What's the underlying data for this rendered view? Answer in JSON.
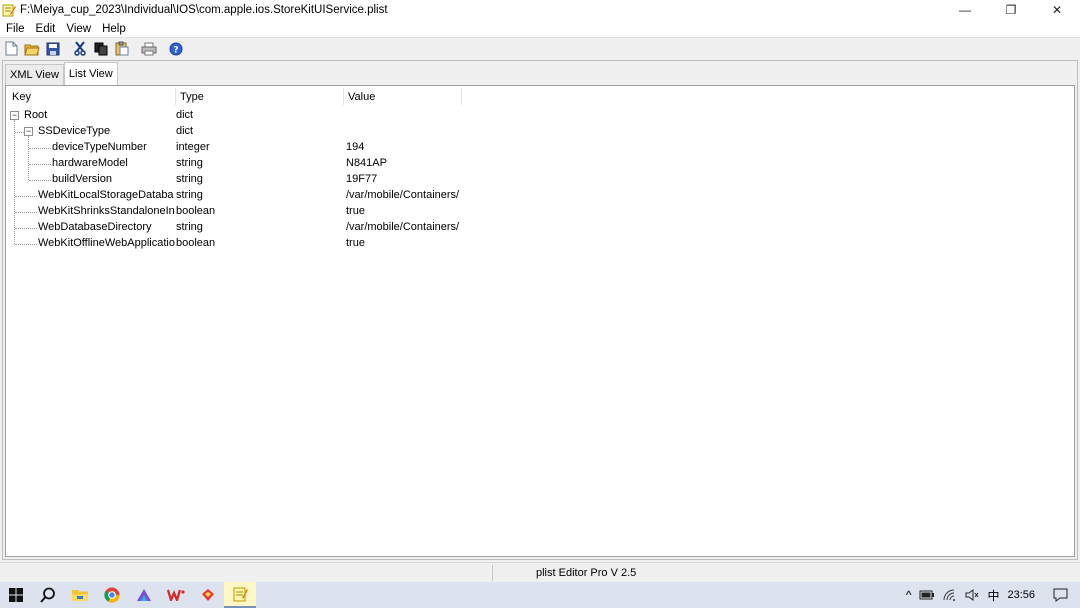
{
  "window": {
    "title": "F:\\Meiya_cup_2023\\Individual\\IOS\\com.apple.ios.StoreKitUIService.plist",
    "minimize": "—",
    "restore": "❐",
    "close": "✕"
  },
  "menu": [
    "File",
    "Edit",
    "View",
    "Help"
  ],
  "toolbar": {
    "icons": [
      "new-file-icon",
      "open-folder-icon",
      "save-icon",
      "cut-icon",
      "copy-icon",
      "paste-icon",
      "print-icon",
      "help-icon"
    ]
  },
  "tabs": [
    {
      "label": "XML View",
      "active": false
    },
    {
      "label": "List View",
      "active": true
    }
  ],
  "list": {
    "headers": {
      "key": "Key",
      "type": "Type",
      "value": "Value"
    },
    "rows": [
      {
        "key": "Root",
        "type": "dict",
        "value": "",
        "level": 0,
        "expander": "⊟"
      },
      {
        "key": "SSDeviceType",
        "type": "dict",
        "value": "",
        "level": 1,
        "expander": "⊟"
      },
      {
        "key": "deviceTypeNumber",
        "type": "integer",
        "value": "194",
        "level": 2,
        "expander": ""
      },
      {
        "key": "hardwareModel",
        "type": "string",
        "value": "N841AP",
        "level": 2,
        "expander": ""
      },
      {
        "key": "buildVersion",
        "type": "string",
        "value": "19F77",
        "level": 2,
        "expander": ""
      },
      {
        "key": "WebKitLocalStorageDataba",
        "type": "string",
        "value": "/var/mobile/Containers/",
        "level": 1,
        "expander": ""
      },
      {
        "key": "WebKitShrinksStandaloneIn",
        "type": "boolean",
        "value": "true",
        "level": 1,
        "expander": ""
      },
      {
        "key": "WebDatabaseDirectory",
        "type": "string",
        "value": "/var/mobile/Containers/",
        "level": 1,
        "expander": ""
      },
      {
        "key": "WebKitOfflineWebApplicatio",
        "type": "boolean",
        "value": "true",
        "level": 1,
        "expander": ""
      }
    ]
  },
  "status": {
    "text": "plist Editor Pro V 2.5"
  },
  "taskbar": {
    "icons": [
      "windows-start-icon",
      "search-icon",
      "file-explorer-icon",
      "chrome-icon",
      "app-icon",
      "wps-icon",
      "tool-icon",
      "notepad-icon"
    ],
    "tray": {
      "chevron": "^",
      "ime": "中",
      "time": "23:56"
    }
  },
  "colors": {
    "taskbar": "#dde3ee",
    "active_task": "#fff6c6",
    "help_blue": "#2f62d6"
  }
}
